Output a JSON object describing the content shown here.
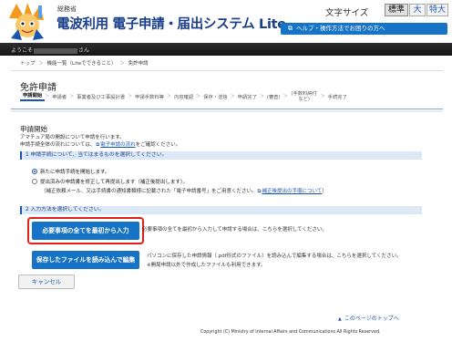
{
  "header": {
    "ministry": "総務省",
    "system_title": "電波利用 電子申請・届出システム Lite",
    "font_size_label": "文字サイズ",
    "font_sizes": [
      "標準",
      "大",
      "特大"
    ],
    "help_button": "ヘルプ・操作方法でお困りの方へ"
  },
  "userbar": {
    "prefix": "ようこそ",
    "suffix": "さん"
  },
  "breadcrumb": [
    "トップ",
    "＞",
    "機能一覧（Liteでできること）",
    "＞",
    "免許申請"
  ],
  "page_title": "免許申請",
  "steps": [
    {
      "label": "申請開始",
      "active": true
    },
    {
      "label": "申請者"
    },
    {
      "label": "事業者及び工事設計書"
    },
    {
      "label": "申請手数料等"
    },
    {
      "label": "内容確認"
    },
    {
      "label": "保存・送信"
    },
    {
      "label": "申請完了"
    },
    {
      "label": "(審査)"
    },
    {
      "label": "(手数料納付など)",
      "two_line": true
    },
    {
      "label": "手続完了"
    }
  ],
  "main": {
    "section_heading": "申請開始",
    "desc1": "アマチュア局の開設について申請を行います。",
    "desc2_pre": "申請手続全体の流れについては、",
    "desc2_link": "電子申請の流れ",
    "desc2_post": "をご確認ください。",
    "band1": "1 申請手続について、当てはまるものを選択してください。",
    "radio1": "新たに申請手続を開始します。",
    "radio2": "提出済みの申請書を修正して再提出します（補正後提出します）。",
    "radio2_note_pre": "（補正依頼メール、又は手続書の通知書類様に記載された「電子申請番号」をご用意ください。",
    "radio2_note_link": "補正後提出の手順について",
    "radio2_note_post": "）",
    "band2": "2 入力方法を選択してください。",
    "btn_all": "必要事項の全てを最初から入力",
    "opt1_desc": "必要事項の全てを最初から入力して申請する場合は、こちらを選択してください。",
    "btn_file": "保存したファイルを読み込んで編集",
    "opt2_desc1": "パソコンに保存した申請情報（.pdf形式のファイル）を読み込んで編集する場合は、こちらを選択してください。",
    "opt2_desc2": "※開局申請以外で作成したファイルも利用できます。",
    "cancel": "キャンセル"
  },
  "footer": {
    "to_top": "このページのトップへ",
    "copyright": "Copyright (C) Ministry of Internal Affairs and Communications All Rights Reserved."
  },
  "colors": {
    "accent": "#1673c6",
    "title": "#1a3f8a",
    "highlight": "#e0211b"
  }
}
